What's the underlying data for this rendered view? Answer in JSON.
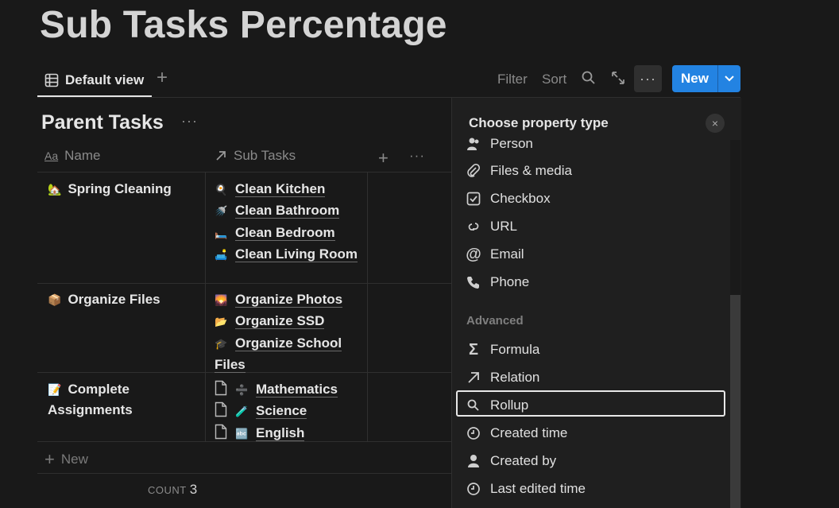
{
  "page": {
    "title": "Sub Tasks Percentage"
  },
  "toolbar": {
    "view_label": "Default view",
    "add_view": "+",
    "filter_label": "Filter",
    "sort_label": "Sort",
    "more_label": "···",
    "new_label": "New",
    "accent": "#2383e2"
  },
  "table": {
    "title": "Parent Tasks",
    "title_more": "···",
    "columns": [
      {
        "label": "Name",
        "icon": "text-aa-icon"
      },
      {
        "label": "Sub Tasks",
        "icon": "relation-arrow-icon"
      }
    ],
    "add_column": "+",
    "column_more": "···",
    "rows": [
      {
        "name": "Spring Cleaning",
        "emoji": "🏡",
        "subtasks": [
          {
            "emoji": "🍳",
            "label": "Clean Kitchen"
          },
          {
            "emoji": "🚿",
            "label": "Clean Bathroom"
          },
          {
            "emoji": "🛏️",
            "label": "Clean Bedroom"
          },
          {
            "emoji": "🛋️",
            "label": "Clean Living Room"
          }
        ]
      },
      {
        "name": "Organize Files",
        "emoji": "📦",
        "subtasks": [
          {
            "emoji": "🌄",
            "label": "Organize Photos"
          },
          {
            "emoji": "📂",
            "label": "Organize SSD"
          },
          {
            "emoji": "🎓",
            "label": "Organize School Files"
          }
        ]
      },
      {
        "name": "Complete Assignments",
        "emoji": "📝",
        "subtasks": [
          {
            "emoji": "➗",
            "label": "Mathematics"
          },
          {
            "emoji": "🧪",
            "label": "Science"
          },
          {
            "emoji": "🔤",
            "label": "English"
          }
        ]
      }
    ],
    "new_row_label": "New",
    "count_label": "COUNT",
    "count_value": "3"
  },
  "panel": {
    "title": "Choose property type",
    "close": "×",
    "basic_options": [
      {
        "label": "Person",
        "icon": "person-icon"
      },
      {
        "label": "Files & media",
        "icon": "paperclip-icon"
      },
      {
        "label": "Checkbox",
        "icon": "checkbox-icon"
      },
      {
        "label": "URL",
        "icon": "link-icon"
      },
      {
        "label": "Email",
        "icon": "at-icon"
      },
      {
        "label": "Phone",
        "icon": "phone-icon"
      }
    ],
    "section_label": "Advanced",
    "advanced_options": [
      {
        "label": "Formula",
        "icon": "sigma-icon"
      },
      {
        "label": "Relation",
        "icon": "arrow-up-right-icon"
      },
      {
        "label": "Rollup",
        "icon": "magnifier-icon",
        "selected": true
      },
      {
        "label": "Created time",
        "icon": "clock-icon"
      },
      {
        "label": "Created by",
        "icon": "person-icon"
      },
      {
        "label": "Last edited time",
        "icon": "clock-icon"
      }
    ]
  }
}
